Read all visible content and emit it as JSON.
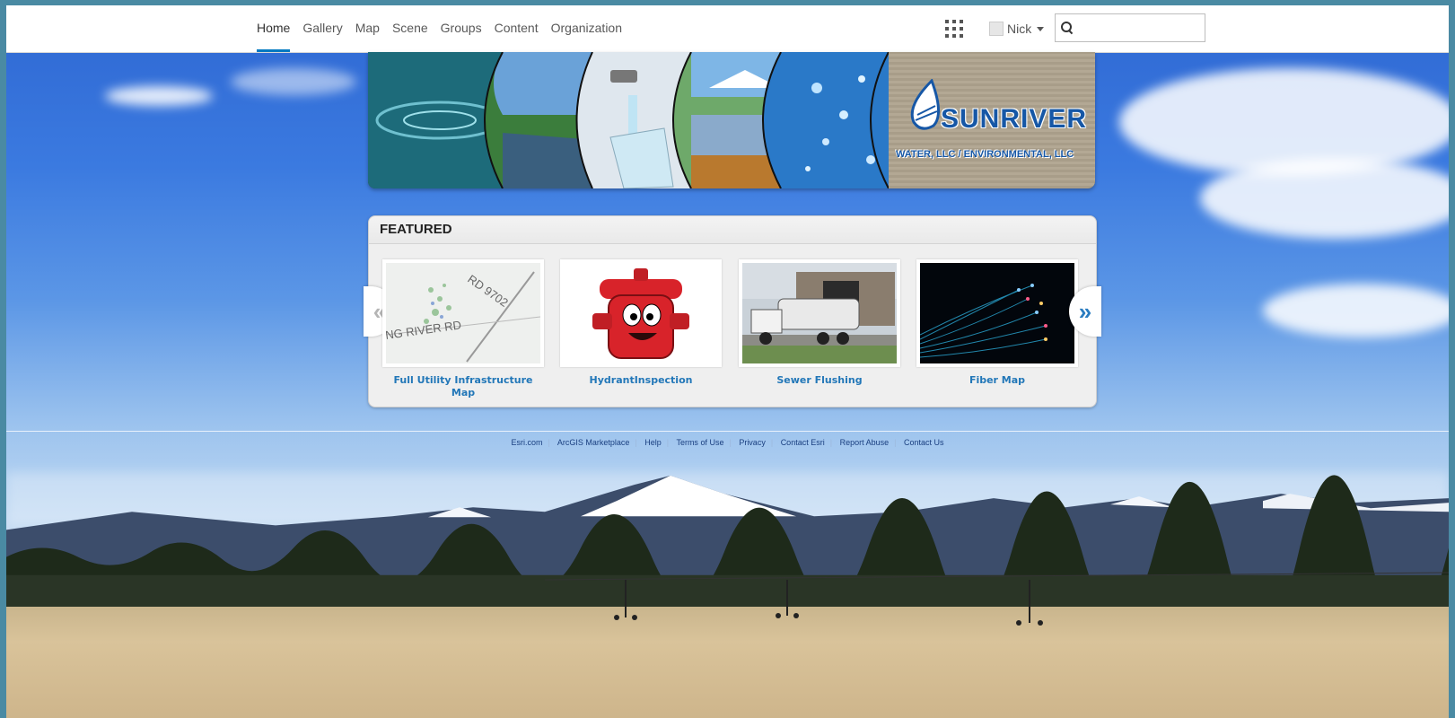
{
  "nav": {
    "items": [
      {
        "label": "Home",
        "active": true
      },
      {
        "label": "Gallery"
      },
      {
        "label": "Map"
      },
      {
        "label": "Scene"
      },
      {
        "label": "Groups"
      },
      {
        "label": "Content"
      },
      {
        "label": "Organization"
      }
    ],
    "apps_icon": "app-launcher-grid-icon",
    "user": {
      "name": "Nick"
    },
    "search": {
      "value": "",
      "placeholder": ""
    }
  },
  "banner": {
    "brand": "SUNRIVER",
    "subtitle": "WATER, LLC / ENVIRONMENTAL, LLC"
  },
  "featured": {
    "heading": "FEATURED",
    "items": [
      {
        "title": "Full Utility Infrastructure Map",
        "thumb": "map-thumbnail",
        "map_labels": [
          "RD 9702",
          "NG RIVER RD"
        ]
      },
      {
        "title": "HydrantInspection",
        "thumb": "hydrant-mascot"
      },
      {
        "title": "Sewer Flushing",
        "thumb": "truck-photo"
      },
      {
        "title": "Fiber Map",
        "thumb": "fiber-optic-photo"
      }
    ],
    "prev": "«",
    "next": "»"
  },
  "footer": {
    "links": [
      "Esri.com",
      "ArcGIS Marketplace",
      "Help",
      "Terms of Use",
      "Privacy",
      "Contact Esri",
      "Report Abuse",
      "Contact Us"
    ]
  },
  "colors": {
    "accent": "#0079c1",
    "link": "#2277b8",
    "brand": "#1657a6"
  }
}
